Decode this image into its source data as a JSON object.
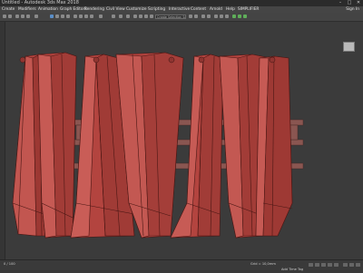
{
  "window": {
    "title": "Untitled - Autodesk 3ds Max 2018",
    "min": "–",
    "max": "□",
    "close": "✕"
  },
  "menu": {
    "items": [
      "Create",
      "Modifiers",
      "Animation",
      "Graph Editors",
      "Rendering",
      "Civil View",
      "Customize",
      "Scripting",
      "Interactive",
      "Content",
      "Arnold",
      "Help",
      "SIMPLIFIER"
    ],
    "sign_in": "Sign In"
  },
  "toolbar": {
    "selection_set_placeholder": "Create Selection Se"
  },
  "viewport": {
    "shading_color": "#b3443f",
    "edge_color": "#4a1714",
    "background": "#3b3b3b"
  },
  "status": {
    "grid": "Grid = 10,0mm",
    "autokey": "Add Time Tag",
    "frame": "0 / 100"
  },
  "colors": {
    "accent": "#5a8ec8",
    "panel": "#444444"
  }
}
